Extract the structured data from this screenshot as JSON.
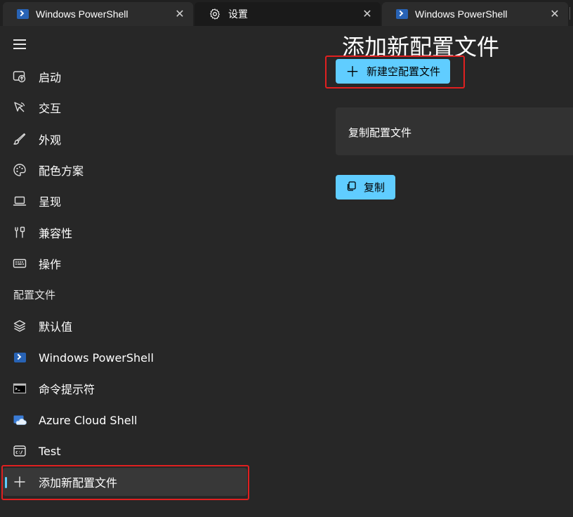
{
  "tabs": [
    {
      "label": "Windows PowerShell",
      "icon": "powershell-icon",
      "active": false
    },
    {
      "label": "设置",
      "icon": "gear-icon",
      "active": true
    },
    {
      "label": "Windows PowerShell",
      "icon": "powershell-icon",
      "active": false
    }
  ],
  "sidebar": {
    "menu_icon": "hamburger-menu-icon",
    "items": [
      {
        "label": "启动",
        "icon": "startup-icon"
      },
      {
        "label": "交互",
        "icon": "pointer-icon"
      },
      {
        "label": "外观",
        "icon": "brush-icon"
      },
      {
        "label": "配色方案",
        "icon": "palette-icon"
      },
      {
        "label": "呈现",
        "icon": "laptop-icon"
      },
      {
        "label": "兼容性",
        "icon": "tools-icon"
      },
      {
        "label": "操作",
        "icon": "keyboard-icon"
      }
    ],
    "profiles_header": "配置文件",
    "profiles": [
      {
        "label": "默认值",
        "icon": "layers-icon"
      },
      {
        "label": "Windows PowerShell",
        "icon": "powershell-icon"
      },
      {
        "label": "命令提示符",
        "icon": "cmd-icon"
      },
      {
        "label": "Azure Cloud Shell",
        "icon": "azure-cloud-icon"
      },
      {
        "label": "Test",
        "icon": "terminal-icon"
      },
      {
        "label": "添加新配置文件",
        "icon": "plus-icon",
        "selected": true
      }
    ]
  },
  "main": {
    "title": "添加新配置文件",
    "new_empty_button": "新建空配置文件",
    "duplicate_card_label": "复制配置文件",
    "duplicate_button": "复制"
  },
  "colors": {
    "accent": "#60cdff",
    "background": "#272727",
    "tabbar": "#202020",
    "highlight_outline": "#e02020"
  }
}
